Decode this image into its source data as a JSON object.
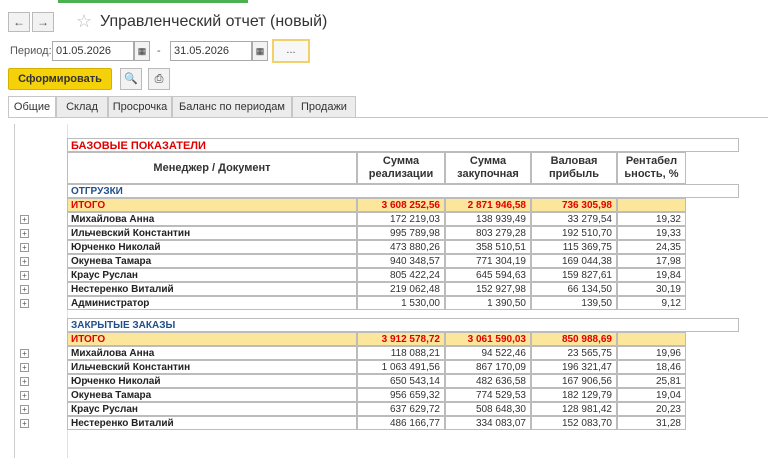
{
  "window": {
    "title": "Управленческий отчет (новый)"
  },
  "period": {
    "label": "Период:",
    "from": "01.05.2026",
    "dash": "-",
    "to": "31.05.2026",
    "dots": "..."
  },
  "toolbar": {
    "form_label": "Сформировать"
  },
  "tabs": [
    "Общие",
    "Склад",
    "Просрочка",
    "Баланс по периодам",
    "Продажи"
  ],
  "report": {
    "title": "БАЗОВЫЕ ПОКАЗАТЕЛИ",
    "columns": [
      "Менеджер / Документ",
      "Сумма реализации",
      "Сумма закупочная",
      "Валовая прибыль",
      "Рентабельность, %"
    ],
    "col_lines": [
      [
        "Сумма",
        "реализации"
      ],
      [
        "Сумма",
        "закупочная"
      ],
      [
        "Валовая",
        "прибыль"
      ],
      [
        "Рентабел",
        "ьность, %"
      ]
    ],
    "sections": [
      {
        "name": "ОТГРУЗКИ",
        "total_label": "ИТОГО",
        "total": [
          "3 608 252,56",
          "2 871 946,58",
          "736 305,98",
          ""
        ],
        "rows": [
          {
            "name": "Михайлова Анна",
            "values": [
              "172 219,03",
              "138 939,49",
              "33 279,54",
              "19,32"
            ]
          },
          {
            "name": "Ильчевский Константин",
            "values": [
              "995 789,98",
              "803 279,28",
              "192 510,70",
              "19,33"
            ]
          },
          {
            "name": "Юрченко Николай",
            "values": [
              "473 880,26",
              "358 510,51",
              "115 369,75",
              "24,35"
            ]
          },
          {
            "name": "Окунева Тамара",
            "values": [
              "940 348,57",
              "771 304,19",
              "169 044,38",
              "17,98"
            ]
          },
          {
            "name": "Краус Руслан",
            "values": [
              "805 422,24",
              "645 594,63",
              "159 827,61",
              "19,84"
            ]
          },
          {
            "name": "Нестеренко Виталий",
            "values": [
              "219 062,48",
              "152 927,98",
              "66 134,50",
              "30,19"
            ]
          },
          {
            "name": "Администратор",
            "values": [
              "1 530,00",
              "1 390,50",
              "139,50",
              "9,12"
            ]
          }
        ]
      },
      {
        "name": "ЗАКРЫТЫЕ ЗАКАЗЫ",
        "total_label": "ИТОГО",
        "total": [
          "3 912 578,72",
          "3 061 590,03",
          "850 988,69",
          ""
        ],
        "rows": [
          {
            "name": "Михайлова Анна",
            "values": [
              "118 088,21",
              "94 522,46",
              "23 565,75",
              "19,96"
            ]
          },
          {
            "name": "Ильчевский Константин",
            "values": [
              "1 063 491,56",
              "867 170,09",
              "196 321,47",
              "18,46"
            ]
          },
          {
            "name": "Юрченко Николай",
            "values": [
              "650 543,14",
              "482 636,58",
              "167 906,56",
              "25,81"
            ]
          },
          {
            "name": "Окунева Тамара",
            "values": [
              "956 659,32",
              "774 529,53",
              "182 129,79",
              "19,04"
            ]
          },
          {
            "name": "Краус Руслан",
            "values": [
              "637 629,72",
              "508 648,30",
              "128 981,42",
              "20,23"
            ]
          },
          {
            "name": "Нестеренко Виталий",
            "values": [
              "486 166,77",
              "334 083,07",
              "152 083,70",
              "31,28"
            ]
          }
        ]
      }
    ]
  }
}
